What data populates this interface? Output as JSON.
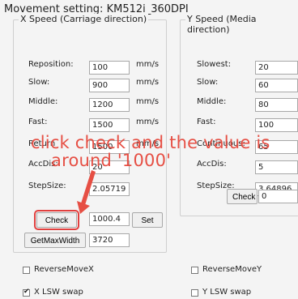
{
  "window": {
    "title": "Movement setting:  KM512i_360DPI"
  },
  "x_group": {
    "title": "X Speed (Carriage direction)",
    "rows": [
      {
        "label": "Reposition:",
        "value": "100",
        "unit": "mm/s"
      },
      {
        "label": "Slow:",
        "value": "900",
        "unit": "mm/s"
      },
      {
        "label": "Middle:",
        "value": "1200",
        "unit": "mm/s"
      },
      {
        "label": "Fast:",
        "value": "1500",
        "unit": "mm/s"
      },
      {
        "label": "Return",
        "value": "1500",
        "unit": "mm/s"
      },
      {
        "label": "AccDis:",
        "value": "20",
        "unit": ""
      },
      {
        "label": "StepSize:",
        "value": "2.05719",
        "unit": ""
      }
    ],
    "check_label": "Check",
    "check_value": "1000.4",
    "set_label": "Set",
    "getmaxwidth_label": "GetMaxWidth",
    "getmaxwidth_value": "3720"
  },
  "y_group": {
    "title": "Y Speed (Media direction)",
    "rows": [
      {
        "label": "Slowest:",
        "value": "20"
      },
      {
        "label": "Slow:",
        "value": "60"
      },
      {
        "label": "Middle:",
        "value": "80"
      },
      {
        "label": "Fast:",
        "value": "100"
      },
      {
        "label": "Continuous:",
        "value": "65"
      },
      {
        "label": "AccDis:",
        "value": "5"
      },
      {
        "label": "StepSize:",
        "value": "3.64896"
      }
    ],
    "check_label": "Check",
    "check_value": "0"
  },
  "options": {
    "reverse_x": {
      "label": "ReverseMoveX",
      "checked": false
    },
    "x_lsw": {
      "label": "X LSW swap",
      "checked": true
    },
    "reverse_y": {
      "label": "ReverseMoveY",
      "checked": false
    },
    "y_lsw": {
      "label": "Y LSW swap",
      "checked": false
    }
  },
  "annotation": {
    "line1": "click check and the value is",
    "line2": "around '1000'",
    "color": "#e64f44"
  }
}
